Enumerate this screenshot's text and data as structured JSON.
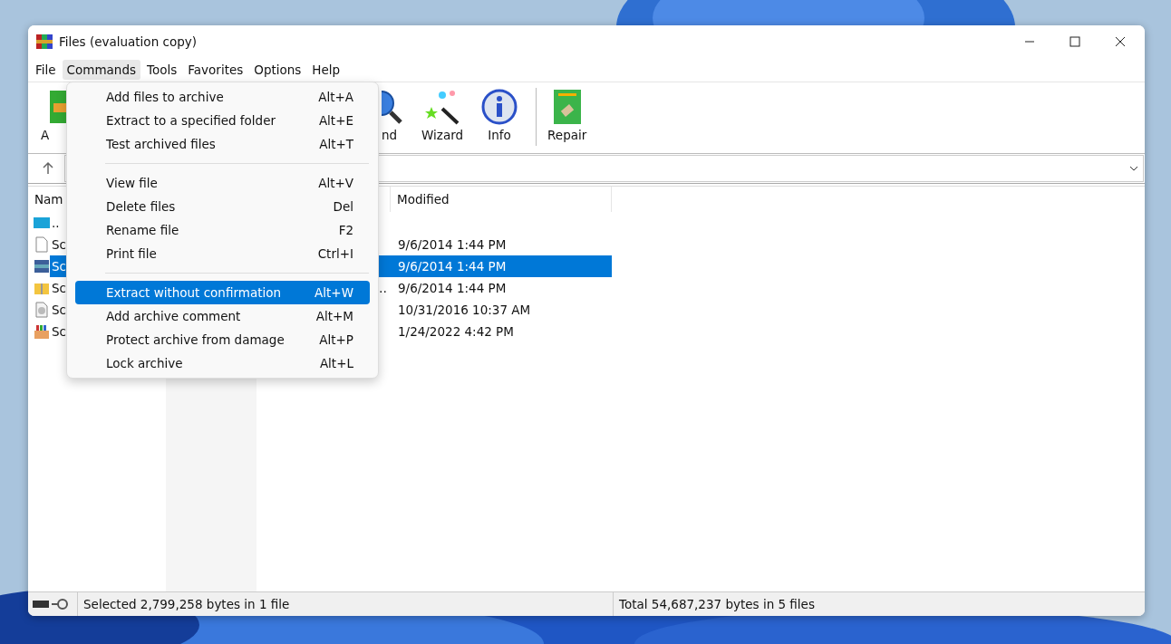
{
  "window": {
    "title": "Files (evaluation copy)"
  },
  "menubar": [
    {
      "label": "File",
      "selected": false
    },
    {
      "label": "Commands",
      "selected": true
    },
    {
      "label": "Tools",
      "selected": false
    },
    {
      "label": "Favorites",
      "selected": false
    },
    {
      "label": "Options",
      "selected": false
    },
    {
      "label": "Help",
      "selected": false
    }
  ],
  "toolbar": [
    {
      "label": "A"
    },
    {
      "label": "nd"
    },
    {
      "label": "Wizard"
    },
    {
      "label": "Info"
    },
    {
      "label": "Repair"
    }
  ],
  "table": {
    "columns": [
      "Nam",
      "Modified"
    ],
    "rows": [
      {
        "name": "..",
        "selected": false
      },
      {
        "name": "Sc",
        "modified": "9/6/2014 1:44 PM",
        "selected": false
      },
      {
        "name": "Sc",
        "modified": "9/6/2014 1:44 PM",
        "selected": true
      },
      {
        "name": "Sc",
        "type": "…",
        "modified": "9/6/2014 1:44 PM",
        "selected": false
      },
      {
        "name": "Sc",
        "modified": "10/31/2016 10:37 AM",
        "selected": false
      },
      {
        "name": "Sc",
        "modified": "1/24/2022 4:42 PM",
        "selected": false
      }
    ]
  },
  "menu": [
    {
      "kind": "item",
      "label": "Add files to archive",
      "shortcut": "Alt+A",
      "selected": false
    },
    {
      "kind": "item",
      "label": "Extract to a specified folder",
      "shortcut": "Alt+E",
      "selected": false
    },
    {
      "kind": "item",
      "label": "Test archived files",
      "shortcut": "Alt+T",
      "selected": false
    },
    {
      "kind": "separator"
    },
    {
      "kind": "item",
      "label": "View file",
      "shortcut": "Alt+V",
      "selected": false
    },
    {
      "kind": "item",
      "label": "Delete files",
      "shortcut": "Del",
      "selected": false
    },
    {
      "kind": "item",
      "label": "Rename file",
      "shortcut": "F2",
      "selected": false
    },
    {
      "kind": "item",
      "label": "Print file",
      "shortcut": "Ctrl+I",
      "selected": false
    },
    {
      "kind": "separator"
    },
    {
      "kind": "item",
      "label": "Extract without confirmation",
      "shortcut": "Alt+W",
      "selected": true
    },
    {
      "kind": "item",
      "label": "Add archive comment",
      "shortcut": "Alt+M",
      "selected": false
    },
    {
      "kind": "item",
      "label": "Protect archive from damage",
      "shortcut": "Alt+P",
      "selected": false
    },
    {
      "kind": "item",
      "label": "Lock archive",
      "shortcut": "Alt+L",
      "selected": false
    }
  ],
  "status_bar": {
    "left": "Selected 2,799,258 bytes in 1 file",
    "right": "Total 54,687,237 bytes in 5 files"
  }
}
